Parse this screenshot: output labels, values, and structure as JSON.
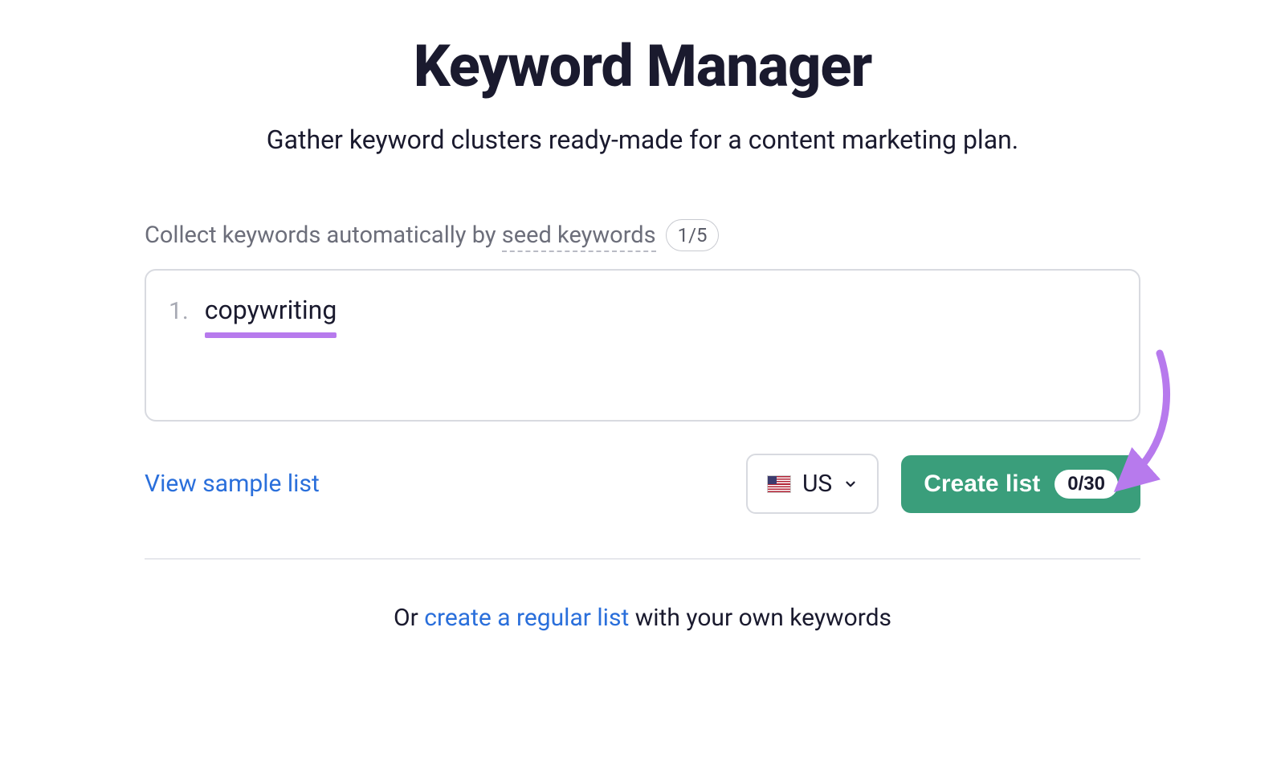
{
  "header": {
    "title": "Keyword Manager",
    "subtitle": "Gather keyword clusters ready-made for a content marketing plan."
  },
  "seed_section": {
    "label_prefix": "Collect keywords automatically by ",
    "label_link": "seed keywords",
    "counter": "1/5"
  },
  "keyword_input": {
    "index": "1.",
    "value": "copywriting"
  },
  "actions": {
    "view_sample_label": "View sample list",
    "country": {
      "code": "US"
    },
    "create_button": {
      "label": "Create list",
      "count": "0/30"
    }
  },
  "alternative": {
    "prefix": "Or ",
    "link": "create a regular list",
    "suffix": " with your own keywords"
  }
}
